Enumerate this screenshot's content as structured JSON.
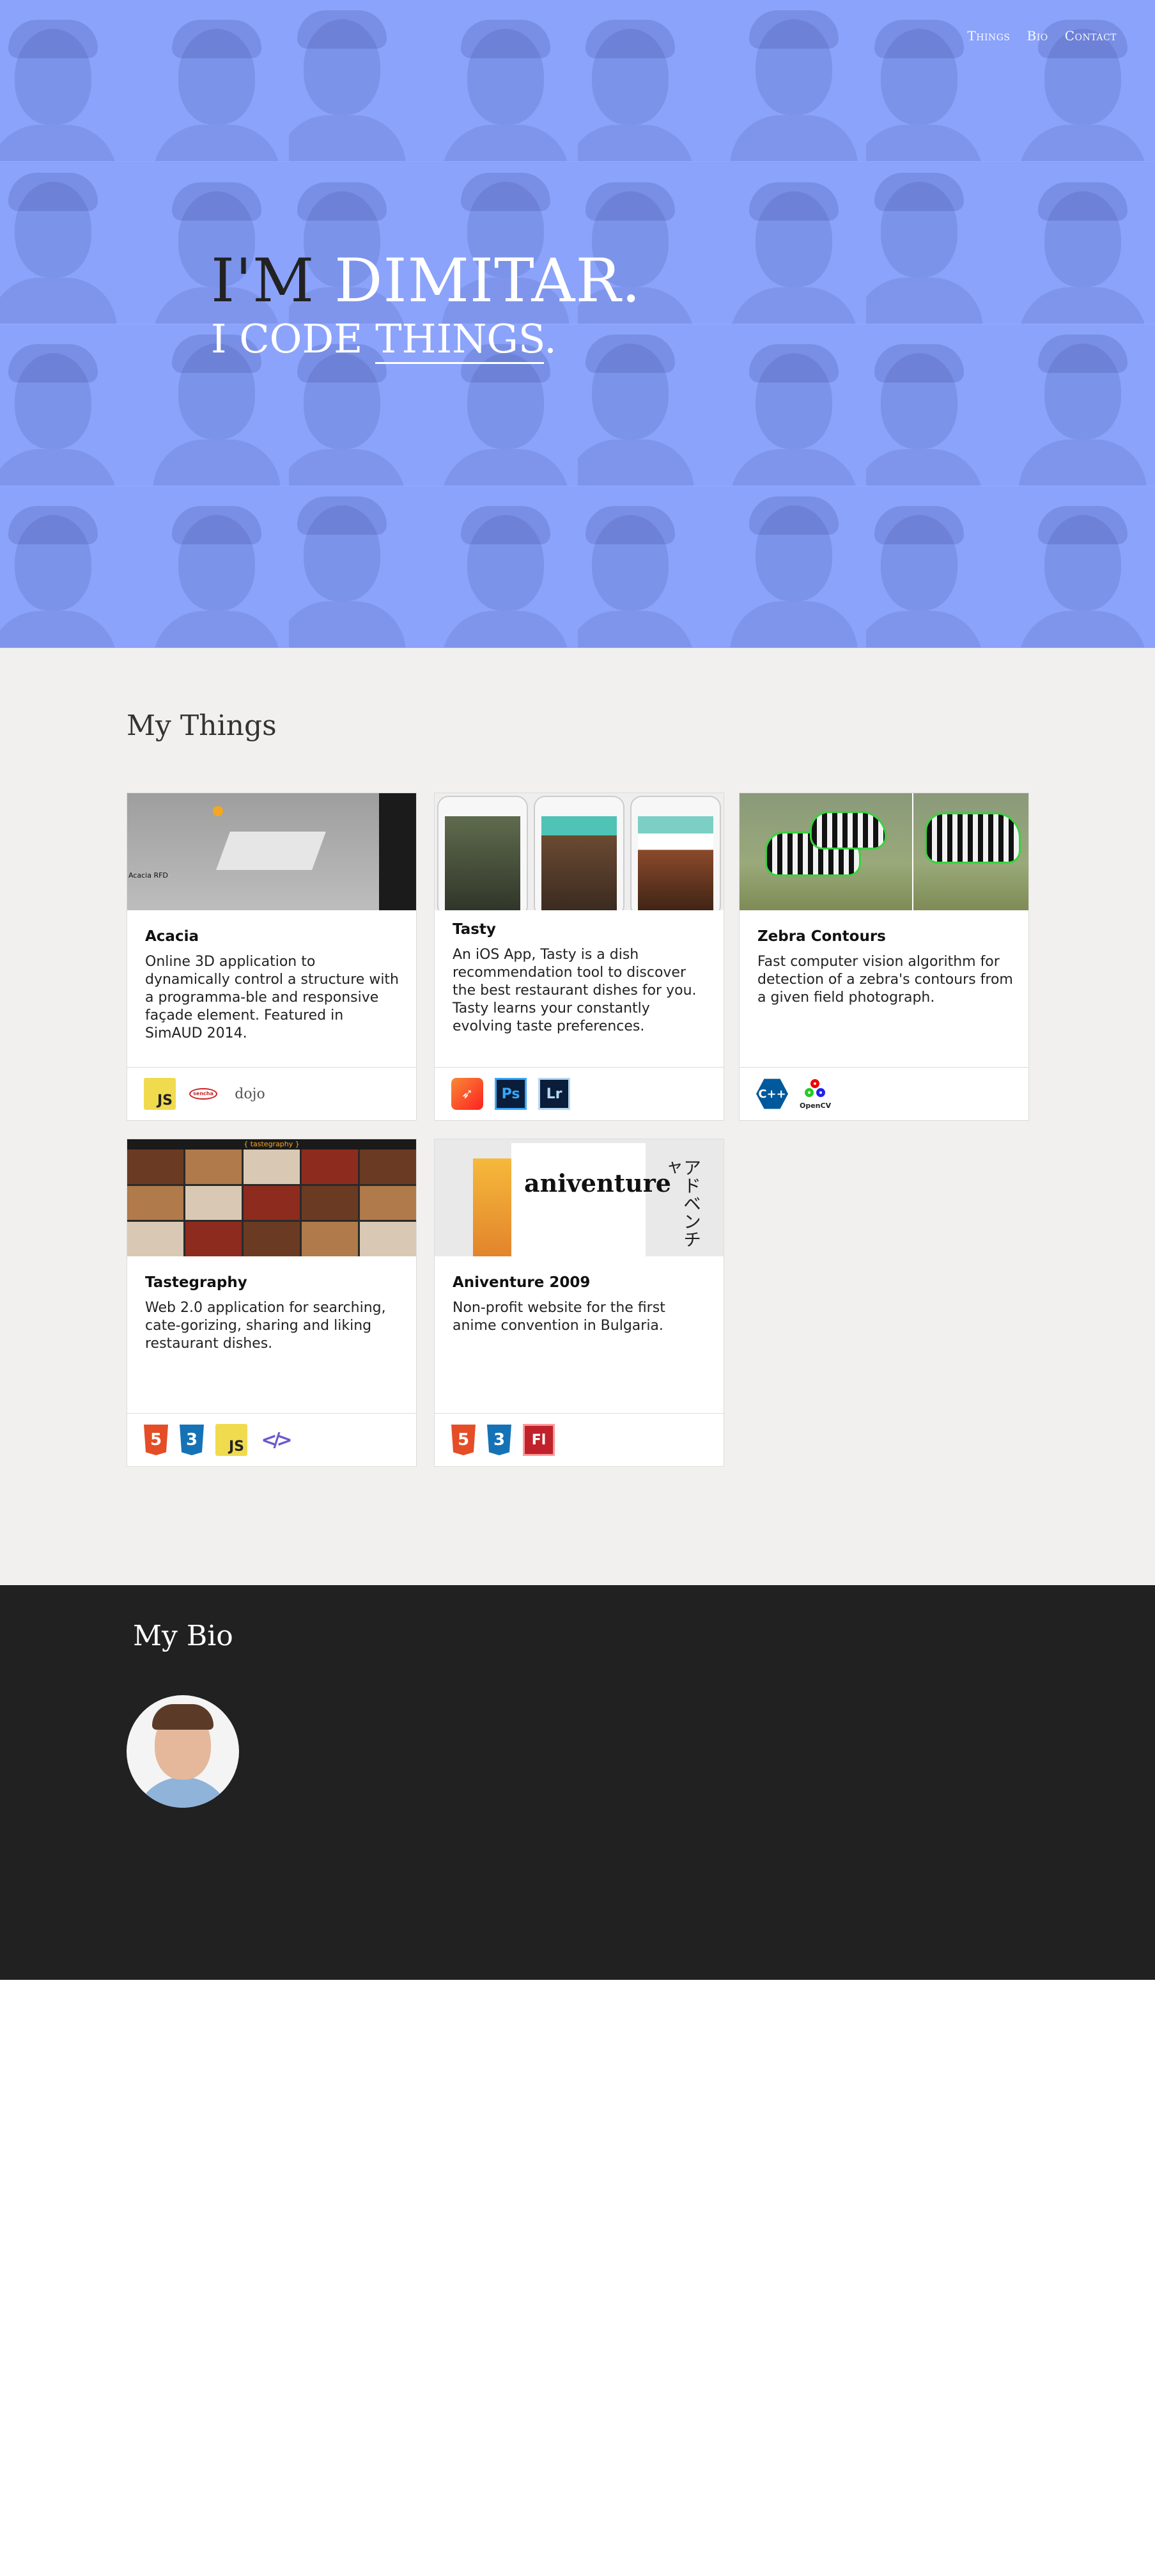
{
  "nav": {
    "items": [
      {
        "label": "Things"
      },
      {
        "label": "Bio"
      },
      {
        "label": "Contact"
      }
    ]
  },
  "hero": {
    "prefix": "I'M",
    "name": "DIMITAR.",
    "line2_prefix": "I CODE",
    "line2_link": "THINGS",
    "line2_suffix": "."
  },
  "things": {
    "title": "My Things",
    "cards": [
      {
        "title": "Acacia",
        "description": "Online 3D application to dynamically control a structure with a programma-ble and responsive façade element. Featured in SimAUD 2014.",
        "image_label": "Acacia RFD",
        "tech": [
          {
            "label": "JS",
            "icon": "javascript-icon"
          },
          {
            "label": "sencha",
            "icon": "sencha-icon"
          },
          {
            "label": "dojo",
            "icon": "dojo-icon"
          }
        ]
      },
      {
        "title": "Tasty",
        "description": "An iOS App, Tasty is a dish recommendation tool to discover the best restaurant dishes for you. Tasty learns your constantly evolving taste preferences.",
        "tech": [
          {
            "label": "",
            "icon": "swift-icon"
          },
          {
            "label": "Ps",
            "icon": "photoshop-icon"
          },
          {
            "label": "Lr",
            "icon": "lightroom-icon"
          }
        ]
      },
      {
        "title": "Zebra Contours",
        "description": "Fast computer vision algorithm for detection of a zebra's contours from a given field photograph.",
        "tech": [
          {
            "label": "C++",
            "icon": "cpp-icon"
          },
          {
            "label": "OpenCV",
            "icon": "opencv-icon"
          }
        ]
      },
      {
        "title": "Tastegraphy",
        "description": "Web 2.0 application for searching, cate-gorizing, sharing and liking restaurant dishes.",
        "image_label": "{ tastegraphy }",
        "tech": [
          {
            "label": "5",
            "icon": "html5-icon"
          },
          {
            "label": "3",
            "icon": "css3-icon"
          },
          {
            "label": "JS",
            "icon": "javascript-icon"
          },
          {
            "label": "</>",
            "icon": "polymer-icon"
          }
        ]
      },
      {
        "title": "Aniventure 2009",
        "description": "Non-profit website for the first anime convention in Bulgaria.",
        "image_label": "aniventure",
        "tech": [
          {
            "label": "5",
            "icon": "html5-icon"
          },
          {
            "label": "3",
            "icon": "css3-icon"
          },
          {
            "label": "Fl",
            "icon": "flash-icon"
          }
        ]
      }
    ]
  },
  "bio": {
    "title": "My Bio"
  },
  "colors": {
    "hero_bg": "#8ba3fb",
    "things_bg": "#f2f0ee",
    "bio_bg": "#212121"
  }
}
